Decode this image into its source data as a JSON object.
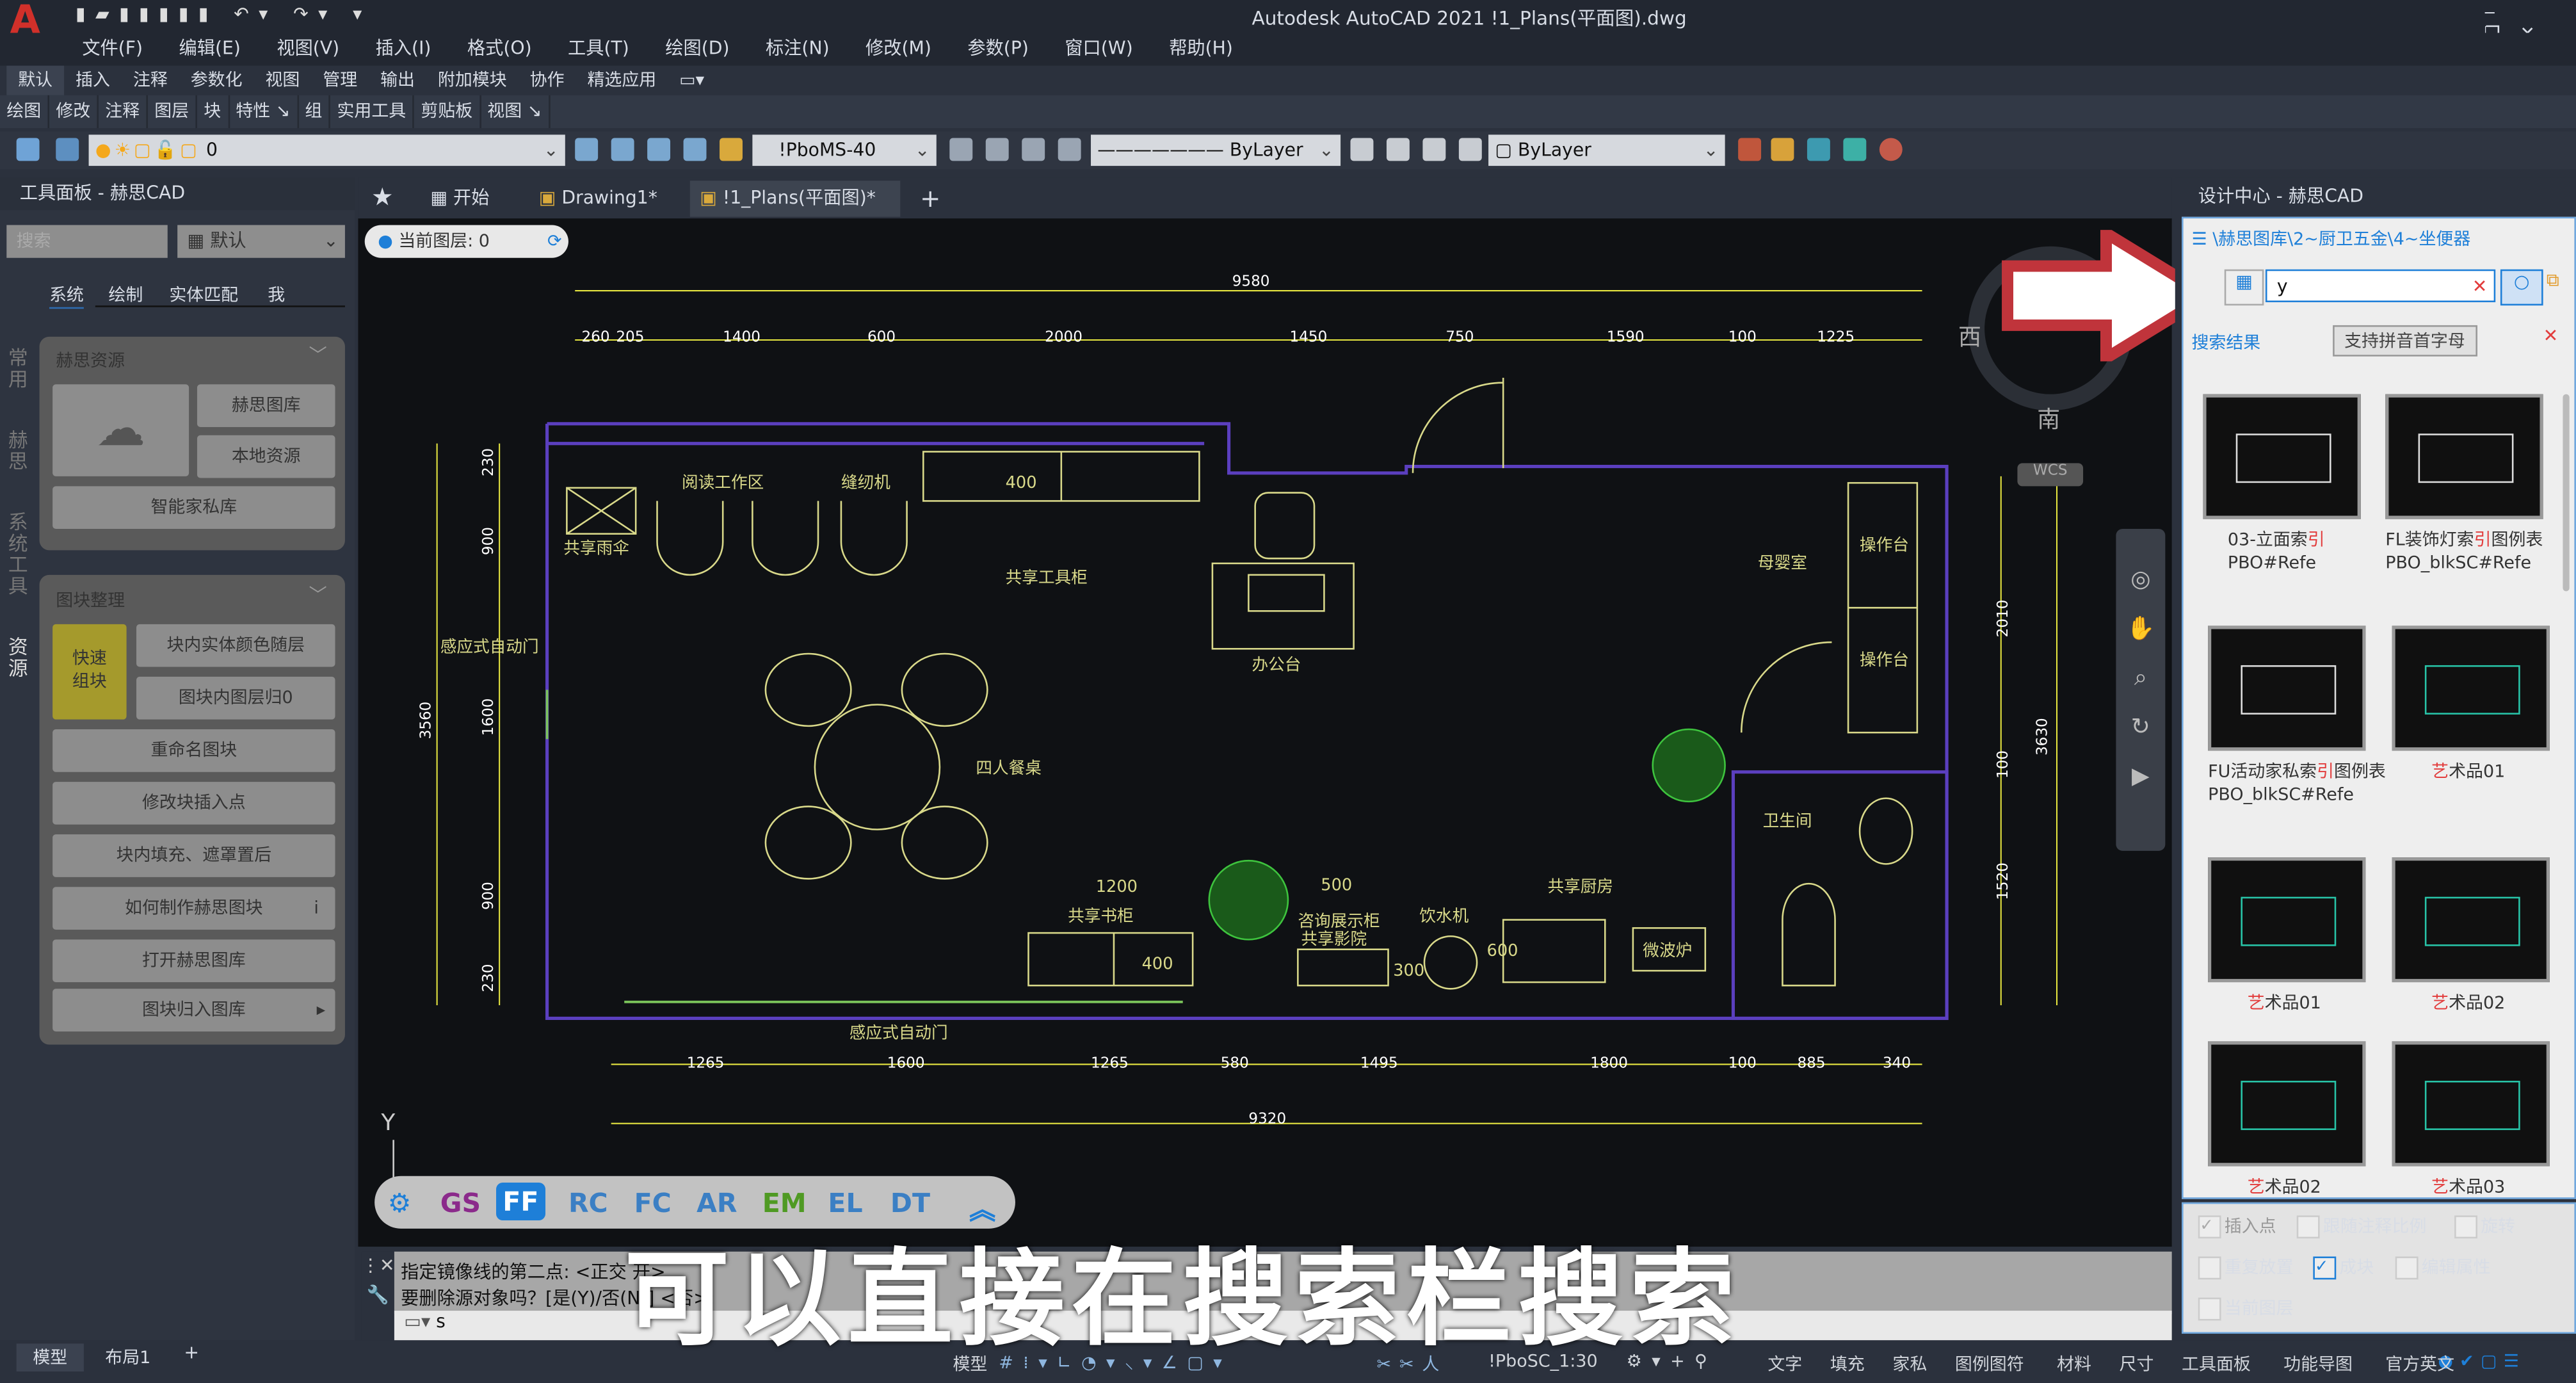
{
  "app": {
    "title": "Autodesk AutoCAD 2021    !1_Plans(平面图).dwg"
  },
  "menu": [
    "文件(F)",
    "编辑(E)",
    "视图(V)",
    "插入(I)",
    "格式(O)",
    "工具(T)",
    "绘图(D)",
    "标注(N)",
    "修改(M)",
    "参数(P)",
    "窗口(W)",
    "帮助(H)"
  ],
  "ribbon_tabs": [
    "默认",
    "插入",
    "注释",
    "参数化",
    "视图",
    "管理",
    "输出",
    "附加模块",
    "协作",
    "精选应用"
  ],
  "ribbon_panels": [
    "绘图",
    "修改",
    "注释",
    "图层",
    "块",
    "特性 ↘",
    "组",
    "实用工具",
    "剪贴板",
    "视图 ↘"
  ],
  "toolbar": {
    "layer": "0",
    "dimstyle": "!PboMS-40",
    "linetype": "ByLayer",
    "color": "ByLayer"
  },
  "left_panel": {
    "title": "工具面板 - 赫思CAD",
    "search_placeholder": "搜索",
    "preset": "默认",
    "tabs": [
      "系统",
      "绘制",
      "实体匹配",
      "我"
    ],
    "side_tabs": [
      "常用",
      "赫思",
      "系统工具",
      "资源"
    ],
    "resources": {
      "header": "赫思资源",
      "buttons": [
        "赫思图库",
        "本地资源",
        "智能家私库"
      ]
    },
    "blocks": {
      "header": "图块整理",
      "quick": "快速组块",
      "buttons": [
        "块内实体颜色随层",
        "图块内图层归0",
        "重命名图块",
        "修改块插入点",
        "块内填充、遮罩置后",
        "如何制作赫思图块",
        "打开赫思图库",
        "图块归入图库"
      ]
    }
  },
  "doc_tabs": {
    "start": "开始",
    "tabs": [
      "Drawing1*",
      "!1_Plans(平面图)*"
    ]
  },
  "viewport": {
    "layer_chip": "当前图层: 0",
    "compass": {
      "west": "西",
      "south": "南",
      "wcs": "WCS"
    },
    "y_axis": "Y",
    "dims_top": {
      "total": "9580",
      "segments": [
        "260",
        "205",
        "1400",
        "600",
        "2000",
        "1450",
        "750",
        "1590",
        "100",
        "1225"
      ]
    },
    "dims_bottom": {
      "total": "9320",
      "segments": [
        "1265",
        "1600",
        "1265",
        "580",
        "1495",
        "1800",
        "100",
        "885",
        "340"
      ]
    },
    "dims_left": {
      "total": "3560",
      "segments": [
        "230",
        "900",
        "1600",
        "900",
        "230"
      ]
    },
    "dims_right": {
      "total": "3630",
      "segments": [
        "2010",
        "100",
        "1520"
      ]
    },
    "rooms": [
      "阅读工作区",
      "缝纫机",
      "400",
      "共享雨伞",
      "共享工具柜",
      "办公台",
      "母婴室",
      "操作台",
      "操作台",
      "感应式自动门",
      "四人餐桌",
      "卫生间",
      "共享厨房",
      "微波炉",
      "饮水机",
      "咨询展示柜",
      "共享影院",
      "共享书柜",
      "1200",
      "500",
      "400",
      "300",
      "600",
      "感应式自动门"
    ],
    "filters": [
      "GS",
      "FF",
      "RC",
      "FC",
      "AR",
      "EM",
      "EL",
      "DT"
    ],
    "filter_colors": [
      "#8b2a8b",
      "#ffffff",
      "#3b7fc4",
      "#3b7fc4",
      "#3b7fc4",
      "#4f9a23",
      "#3b7fc4",
      "#3b7fc4"
    ]
  },
  "command": {
    "lines": [
      "指定镜像线的第二点: <正交 开>",
      "要删除源对象吗？[是(Y)/否(N)] <否>: "
    ],
    "input": "s"
  },
  "subtitle": "可以直接在搜索栏搜索",
  "right_panel": {
    "title": "设计中心 - 赫思CAD",
    "path": "\\赫思图库\\2~厨卫五金\\4~坐便器",
    "search_value": "y",
    "results_label": "搜索结果",
    "hint": "支持拼音首字母",
    "items": [
      {
        "pre": "03-立面索",
        "hl": "引",
        "post": " PBO#Refe"
      },
      {
        "pre": "FL装饰灯索",
        "hl": "引",
        "post": "图例表 PBO_blkSC#Refe"
      },
      {
        "pre": "FU活动家私索",
        "hl": "引",
        "post": "图例表 PBO_blkSC#Refe"
      },
      {
        "pre": "",
        "hl": "艺",
        "post": "术品01"
      },
      {
        "pre": "",
        "hl": "艺",
        "post": "术品01"
      },
      {
        "pre": "",
        "hl": "艺",
        "post": "术品02"
      },
      {
        "pre": "",
        "hl": "艺",
        "post": "术品02"
      },
      {
        "pre": "",
        "hl": "艺",
        "post": "术品03"
      }
    ],
    "options": [
      {
        "label": "插入点",
        "checked": true,
        "disabled": true
      },
      {
        "label": "跟随注释比例",
        "checked": false
      },
      {
        "label": "旋转",
        "checked": false
      },
      {
        "label": "重复放置",
        "checked": false
      },
      {
        "label": "成块",
        "checked": true
      },
      {
        "label": "编辑属性",
        "checked": false
      },
      {
        "label": "当前图层",
        "checked": false
      }
    ]
  },
  "status": {
    "layout_tabs": [
      "模型",
      "布局1"
    ],
    "model": "模型",
    "scale": "!PboSC_1:30",
    "quick": [
      "文字",
      "填充",
      "家私",
      "图例图符",
      "材料",
      "尺寸",
      "工具面板",
      "功能导图",
      "官方英文"
    ]
  },
  "colors": {
    "accent": "#1e7fd8",
    "arrow": "#c0343b",
    "wall": "#5b3fbf",
    "dim": "#e6e640",
    "furniture": "#d9d98a"
  }
}
